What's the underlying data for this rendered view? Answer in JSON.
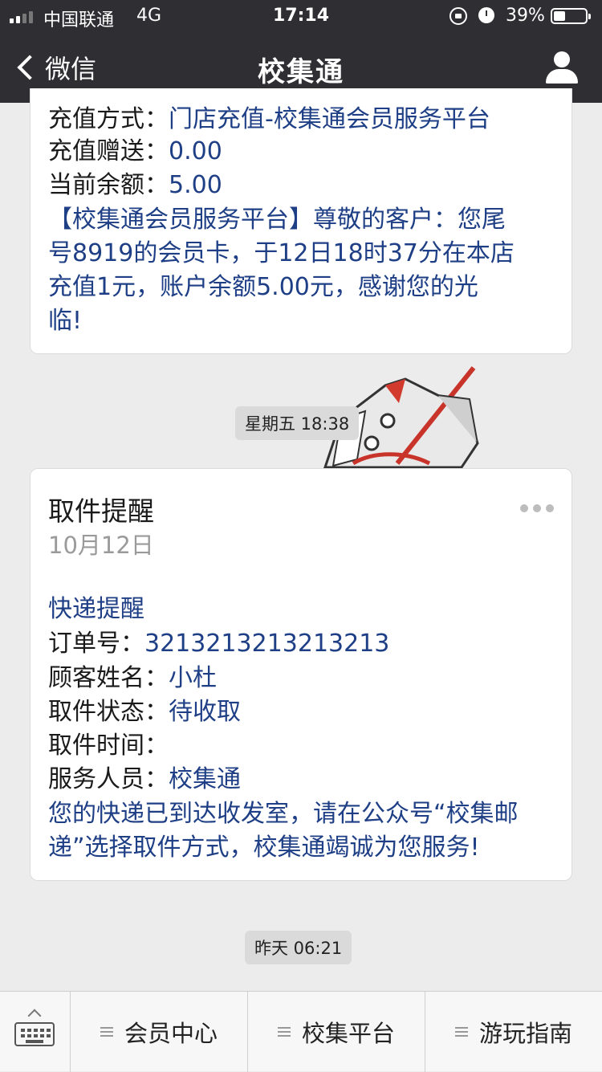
{
  "status_bar": {
    "carrier": "中国联通",
    "network": "4G",
    "time": "17:14",
    "battery": "39%"
  },
  "nav": {
    "back_label": "微信",
    "title": "校集通"
  },
  "message1": {
    "recharge_method_label": "充值方式：",
    "recharge_method_value": "门店充值-校集通会员服务平台",
    "bonus_label": "充值赠送：",
    "bonus_value": "0.00",
    "balance_label": "当前余额：",
    "balance_value": "5.00",
    "notice_lines": [
      "【校集通会员服务平台】尊敬的客户：您尾",
      "号8919的会员卡，于12日18时37分在本店",
      "充值1元，账户余额5.00元，感谢您的光",
      "临!"
    ]
  },
  "timestamp1": "星期五 18:38",
  "message2": {
    "title": "取件提醒",
    "date": "10月12日",
    "heading": "快递提醒",
    "order_label": "订单号：",
    "order_value": "3213213213213213",
    "customer_label": "顾客姓名：",
    "customer_value": "小杜",
    "status_label": "取件状态：",
    "status_value": "待收取",
    "pickup_time_label": "取件时间：",
    "pickup_time_value": "",
    "staff_label": "服务人员：",
    "staff_value": "校集通",
    "footer_lines": [
      "您的快递已到达收发室，请在公众号“校集邮",
      "递”选择取件方式，校集通竭诚为您服务!"
    ]
  },
  "timestamp2": "昨天 06:21",
  "bottom_menu": {
    "items": [
      "会员中心",
      "校集平台",
      "游玩指南"
    ]
  },
  "colors": {
    "nav_bg": "#2e2e33",
    "chat_bg": "#ececec",
    "value_blue": "#1e3f86"
  },
  "icons": [
    "signal-icon",
    "lock-icon",
    "alarm-icon",
    "battery-icon",
    "back-chevron-icon",
    "profile-icon",
    "more-icon",
    "keyboard-icon",
    "hamburger-icon"
  ]
}
